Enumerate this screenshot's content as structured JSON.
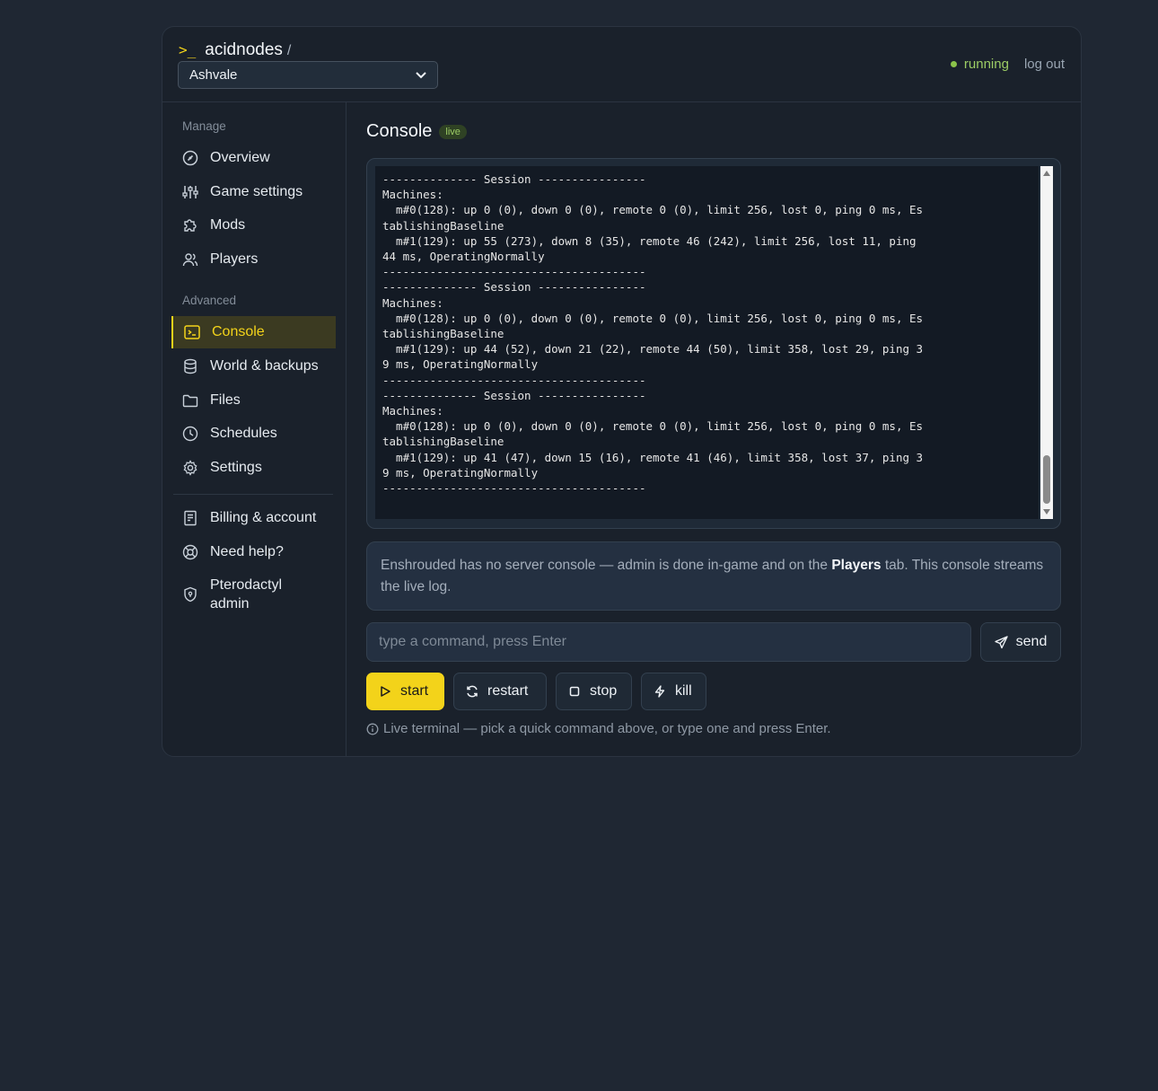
{
  "header": {
    "prompt": ">_",
    "app_name": "acidnodes",
    "separator": "/",
    "server_select": {
      "value": "Ashvale"
    },
    "status_text": "running",
    "logout_label": "log out"
  },
  "sidebar": {
    "manage_label": "Manage",
    "advanced_label": "Advanced",
    "manage_items": [
      {
        "label": "Overview",
        "icon": "gauge-icon"
      },
      {
        "label": "Game settings",
        "icon": "sliders-icon"
      },
      {
        "label": "Mods",
        "icon": "puzzle-icon"
      },
      {
        "label": "Players",
        "icon": "users-icon"
      }
    ],
    "advanced_items": [
      {
        "label": "Console",
        "icon": "terminal-icon",
        "active": true
      },
      {
        "label": "World & backups",
        "icon": "database-icon"
      },
      {
        "label": "Files",
        "icon": "folder-icon"
      },
      {
        "label": "Schedules",
        "icon": "clock-icon"
      },
      {
        "label": "Settings",
        "icon": "gear-icon"
      }
    ],
    "account_items": [
      {
        "label": "Billing & account",
        "icon": "receipt-icon"
      },
      {
        "label": "Need help?",
        "icon": "lifebuoy-icon"
      },
      {
        "label": "Pterodactyl admin",
        "icon": "shield-icon"
      }
    ]
  },
  "main": {
    "title": "Console",
    "badge": "live",
    "console_log": "-------------- Session ----------------\nMachines:\n  m#0(128): up 0 (0), down 0 (0), remote 0 (0), limit 256, lost 0, ping 0 ms, Es\ntablishingBaseline\n  m#1(129): up 55 (273), down 8 (35), remote 46 (242), limit 256, lost 11, ping\n44 ms, OperatingNormally\n---------------------------------------\n-------------- Session ----------------\nMachines:\n  m#0(128): up 0 (0), down 0 (0), remote 0 (0), limit 256, lost 0, ping 0 ms, Es\ntablishingBaseline\n  m#1(129): up 44 (52), down 21 (22), remote 44 (50), limit 358, lost 29, ping 3\n9 ms, OperatingNormally\n---------------------------------------\n-------------- Session ----------------\nMachines:\n  m#0(128): up 0 (0), down 0 (0), remote 0 (0), limit 256, lost 0, ping 0 ms, Es\ntablishingBaseline\n  m#1(129): up 41 (47), down 15 (16), remote 41 (46), limit 358, lost 37, ping 3\n9 ms, OperatingNormally\n---------------------------------------",
    "note_before": "Enshrouded has no server console — admin is done in-game and on the ",
    "note_bold": "Players",
    "note_after": " tab. This console streams the live log.",
    "command_placeholder": "type a command, press Enter",
    "send_label": "send",
    "buttons": [
      {
        "label": "start",
        "icon": "play-icon"
      },
      {
        "label": "restart",
        "icon": "refresh-icon"
      },
      {
        "label": "stop",
        "icon": "stop-icon"
      },
      {
        "label": "kill",
        "icon": "bolt-icon"
      }
    ],
    "hint": "Live terminal — pick a quick command above, or type one and press Enter."
  },
  "colors": {
    "accent": "#f3d31a",
    "running": "#9ccc65",
    "background": "#1f2733",
    "panel": "#1a212b"
  }
}
